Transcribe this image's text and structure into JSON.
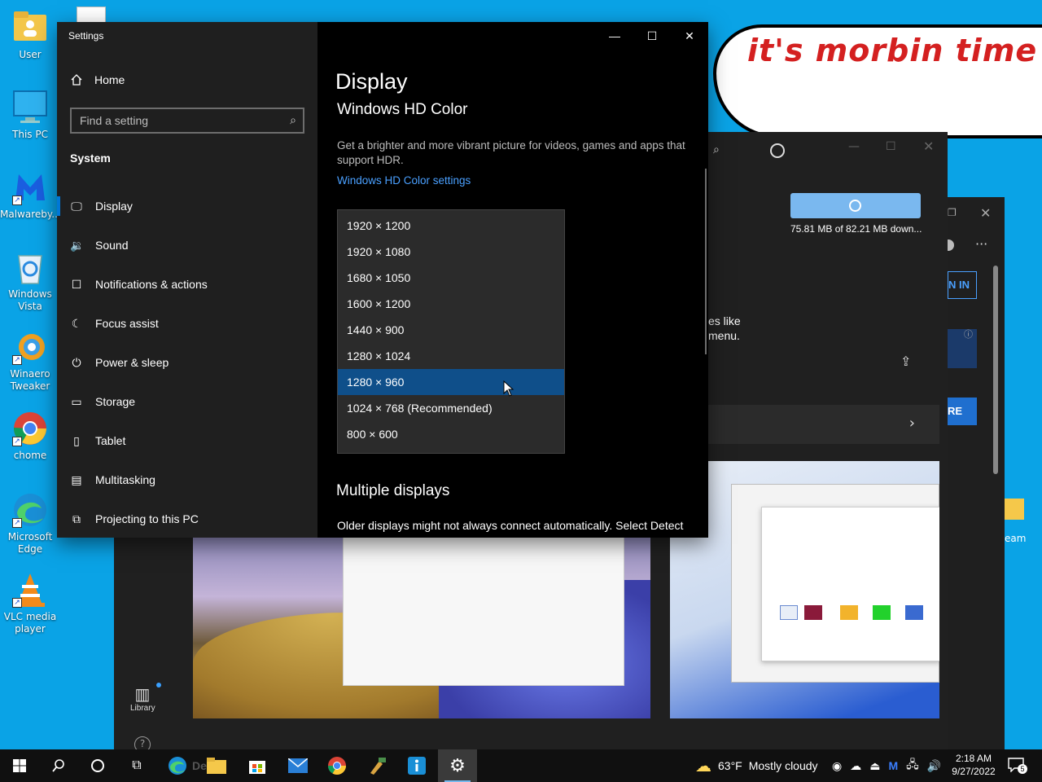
{
  "desktop": {
    "icons": [
      {
        "label": "User"
      },
      {
        "label": "This PC"
      },
      {
        "label": "Malwareby..."
      },
      {
        "label": "Windows Vista"
      },
      {
        "label": "Winaero Tweaker"
      },
      {
        "label": "chome"
      },
      {
        "label": "Microsoft Edge"
      },
      {
        "label": "VLC media player"
      }
    ],
    "bubble_text": "it's morbin  time",
    "edge_text": "eam"
  },
  "store": {
    "download_text": "75.81 MB of 82.21 MB down...",
    "desc_line1": "es like",
    "desc_line2": "menu.",
    "signin_text": "N IN",
    "more_text": "RE",
    "library_label": "Library"
  },
  "settings": {
    "window_title": "Settings",
    "home_label": "Home",
    "search_placeholder": "Find a setting",
    "section_label": "System",
    "nav_items": [
      {
        "label": "Display",
        "icon": "monitor-icon"
      },
      {
        "label": "Sound",
        "icon": "speaker-icon"
      },
      {
        "label": "Notifications & actions",
        "icon": "message-icon"
      },
      {
        "label": "Focus assist",
        "icon": "moon-icon"
      },
      {
        "label": "Power & sleep",
        "icon": "power-icon"
      },
      {
        "label": "Storage",
        "icon": "storage-icon"
      },
      {
        "label": "Tablet",
        "icon": "tablet-icon"
      },
      {
        "label": "Multitasking",
        "icon": "multitasking-icon"
      },
      {
        "label": "Projecting to this PC",
        "icon": "projector-icon"
      }
    ],
    "active_nav": "Display",
    "page_title": "Display",
    "subsection_title": "Windows HD Color",
    "hd_description": "Get a brighter and more vibrant picture for videos, games and apps that support HDR.",
    "hd_link": "Windows HD Color settings",
    "multiple_displays_title": "Multiple displays",
    "multiple_displays_text": "Older displays might not always connect automatically. Select Detect",
    "resolution_options": [
      "1920 × 1200",
      "1920 × 1080",
      "1680 × 1050",
      "1600 × 1200",
      "1440 × 900",
      "1280 × 1024",
      "1280 × 960",
      "1024 × 768 (Recommended)",
      "800 × 600"
    ],
    "selected_resolution": "1280 × 960"
  },
  "taskbar": {
    "search_ghost_text": "De",
    "weather_temp": "63°F",
    "weather_text": "Mostly cloudy",
    "time": "2:18 AM",
    "date": "9/27/2022",
    "notification_count": "5"
  },
  "colors": {
    "desktop": "#0aa3e6",
    "accent": "#0078d7",
    "link": "#4aa0ff",
    "bubble_text": "#d42020"
  }
}
